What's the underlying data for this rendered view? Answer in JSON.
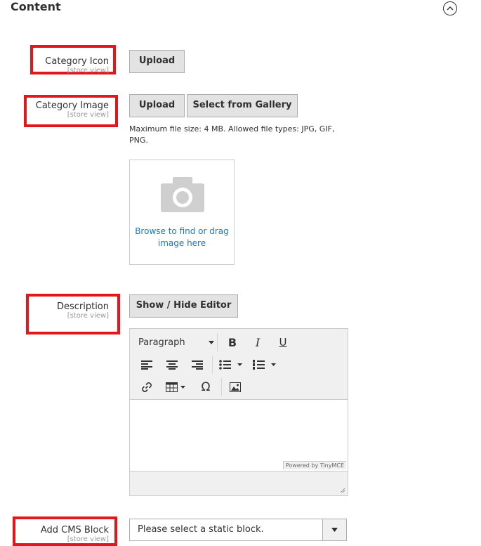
{
  "section": {
    "title": "Content"
  },
  "fields": {
    "category_icon": {
      "label": "Category Icon",
      "scope": "[store view]",
      "upload_label": "Upload"
    },
    "category_image": {
      "label": "Category Image",
      "scope": "[store view]",
      "upload_label": "Upload",
      "gallery_label": "Select from Gallery",
      "note": "Maximum file size: 4 MB. Allowed file types: JPG, GIF, PNG.",
      "browse_text": "Browse to find or drag image here"
    },
    "description": {
      "label": "Description",
      "scope": "[store view]",
      "toggle_label": "Show / Hide Editor",
      "format_select": "Paragraph",
      "bold": "B",
      "italic": "I",
      "underline": "U",
      "special_char": "Ω",
      "powered_by": "Powered by TinyMCE"
    },
    "cms_block": {
      "label": "Add CMS Block",
      "scope": "[store view]",
      "selected": "Please select a static block."
    }
  },
  "icons": {
    "collapse": "chevron-up-icon",
    "camera": "camera-icon",
    "align_left": "align-left-icon",
    "align_center": "align-center-icon",
    "align_right": "align-right-icon",
    "bullet_list": "bullet-list-icon",
    "numbered_list": "numbered-list-icon",
    "link": "link-icon",
    "table": "table-icon",
    "image": "image-icon"
  },
  "colors": {
    "highlight": "#e3161b",
    "link": "#1979c3",
    "button_bg": "#e3e3e3"
  }
}
